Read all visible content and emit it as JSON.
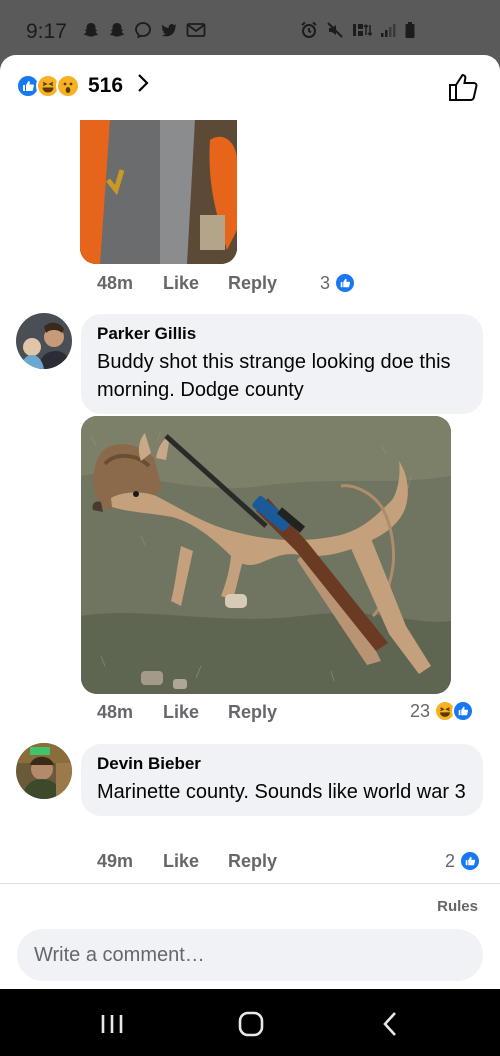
{
  "status_bar": {
    "time": "9:17",
    "left_icons": [
      "snapchat-icon",
      "snapchat-icon",
      "messenger-icon",
      "twitter-icon",
      "mail-icon"
    ],
    "right_icons": [
      "alarm-icon",
      "mute-icon",
      "lte-icon",
      "signal-icon",
      "battery-icon"
    ]
  },
  "header": {
    "reaction_types": [
      "like",
      "haha",
      "wow"
    ],
    "reaction_count": "516"
  },
  "comments": [
    {
      "time": "48m",
      "like_label": "Like",
      "reply_label": "Reply",
      "reaction_count": "3",
      "reactions": [
        "like"
      ]
    },
    {
      "author": "Parker Gillis",
      "text": "Buddy shot this strange looking doe this morning. Dodge county",
      "time": "48m",
      "like_label": "Like",
      "reply_label": "Reply",
      "reaction_count": "23",
      "reactions": [
        "haha",
        "like"
      ]
    },
    {
      "author": "Devin Bieber",
      "text": "Marinette county. Sounds like world war 3",
      "time": "49m",
      "like_label": "Like",
      "reply_label": "Reply",
      "reaction_count": "2",
      "reactions": [
        "like"
      ]
    }
  ],
  "footer": {
    "rules_label": "Rules",
    "comment_placeholder": "Write a comment…"
  },
  "colors": {
    "like_blue": "#1877f2",
    "haha_yellow": "#f7b125",
    "meta_gray": "#65676b",
    "bubble_bg": "#f0f2f5"
  }
}
